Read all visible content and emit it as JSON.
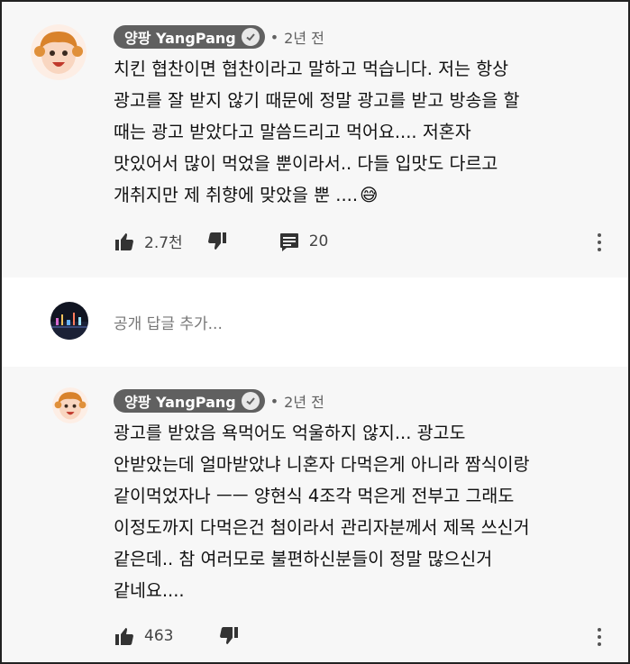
{
  "comments": [
    {
      "author": "양팡 YangPang",
      "age_prefix": "•",
      "age": "2년 전",
      "lines": [
        "치킨 협찬이면 협찬이라고 말하고 먹습니다. 저는 항상",
        "광고를 잘 받지 않기 때문에 정말 광고를 받고 방송을 할",
        "때는 광고 받았다고 말씀드리고 먹어요.... 저혼자",
        "맛있어서 많이 먹었을 뿐이라서.. 다들 입맛도 다르고",
        "개취지만 제 취향에 맞았을 뿐 ...."
      ],
      "emoji": "😅",
      "likes": "2.7천",
      "replies": "20",
      "icons": [
        "like-icon",
        "dislike-icon",
        "reply-comment-icon",
        "more-vert-icon"
      ]
    },
    {
      "author": "양팡 YangPang",
      "age_prefix": "•",
      "age": "2년 전",
      "lines": [
        "광고를 받았음 욕먹어도 억울하지 않지... 광고도",
        "안받았는데 얼마받았냐 니혼자 다먹은게 아니라 짬식이랑",
        "같이먹었자나 ㅡㅡ 양현식 4조각 먹은게 전부고 그래도",
        "이정도까지 다먹은건 첨이라서 관리자분께서 제목 쓰신거",
        "같은데.. 참 여러모로 불편하신분들이 정말 많으신거",
        "같네요...."
      ],
      "likes": "463",
      "icons": [
        "like-icon",
        "dislike-icon",
        "more-vert-icon"
      ]
    }
  ],
  "reply_box": {
    "placeholder": "공개 답글 추가..."
  },
  "colors": {
    "panel_bg": "#f7f7f7",
    "chip_bg": "#606060",
    "emoji": "#f5c518"
  }
}
